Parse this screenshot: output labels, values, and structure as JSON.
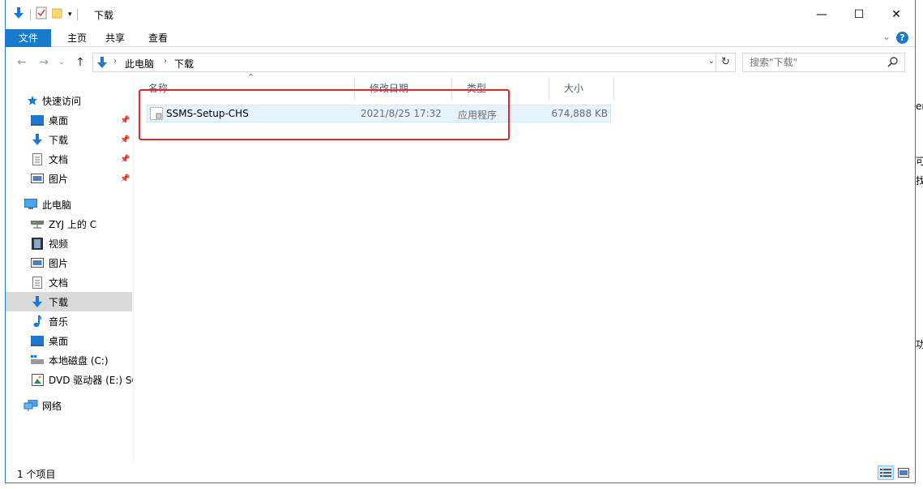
{
  "window": {
    "title": "下载"
  },
  "ribbon": {
    "tabs": [
      "文件",
      "主页",
      "共享",
      "查看"
    ],
    "help_glyph": "?"
  },
  "navbar": {
    "breadcrumb": [
      "此电脑",
      "下载"
    ],
    "search_placeholder": "搜索\"下载\""
  },
  "sidebar": {
    "quick_access": "快速访问",
    "quick_items": [
      "桌面",
      "下载",
      "文档",
      "图片"
    ],
    "this_pc": "此电脑",
    "pc_items": [
      "ZYJ 上的 C",
      "视频",
      "图片",
      "文档",
      "下载",
      "音乐",
      "桌面",
      "本地磁盘 (C:)",
      "DVD 驱动器 (E:) SC"
    ],
    "network": "网络",
    "selected": "下载"
  },
  "columns": {
    "name": "名称",
    "modified": "修改日期",
    "type": "类型",
    "size": "大小"
  },
  "files": [
    {
      "name": "SSMS-Setup-CHS",
      "modified": "2021/8/25 17:32",
      "type": "应用程序",
      "size": "674,888 KB"
    }
  ],
  "status": {
    "item_count": "1 个项目"
  },
  "colors": {
    "accent": "#1979ca",
    "selection": "#e5f3ff",
    "highlight_box": "#e8252b"
  }
}
